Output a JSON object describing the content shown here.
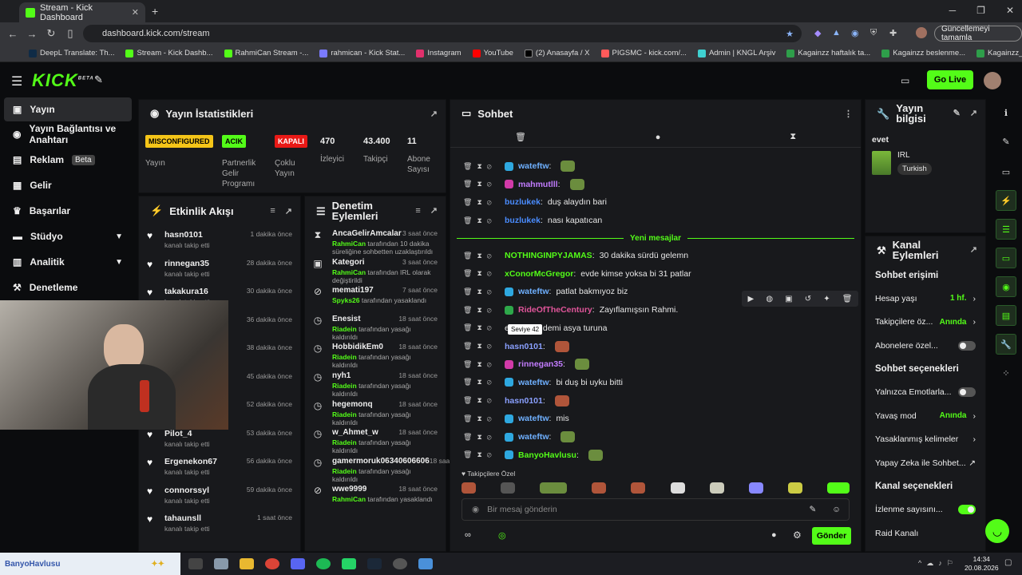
{
  "browser": {
    "tab_title": "Stream - Kick Dashboard",
    "url": "dashboard.kick.com/stream",
    "update_label": "Güncellemeyi tamamla",
    "bookmarks": [
      "DeepL Translate: Th...",
      "Stream - Kick Dashb...",
      "RahmiCan Stream -...",
      "rahmican - Kick Stat...",
      "Instagram",
      "YouTube",
      "(2) Anasayfa / X",
      "PIGSMC - kick.com/...",
      "Admin | KNGL Arşiv",
      "Kagainzz haftalık ta...",
      "Kagainzz beslenme...",
      "Kagainzz_PPLXUL -..."
    ]
  },
  "header": {
    "logo": "KICK",
    "beta": "BETA",
    "go_live": "Go Live"
  },
  "sidebar": {
    "items": [
      {
        "label": "Yayın",
        "icon": "video-icon"
      },
      {
        "label": "Yayın Bağlantısı ve Anahtarı",
        "icon": "broadcast-icon"
      },
      {
        "label": "Reklam",
        "icon": "ad-icon",
        "badge": "Beta"
      },
      {
        "label": "Gelir",
        "icon": "money-icon"
      },
      {
        "label": "Başarılar",
        "icon": "trophy-icon"
      },
      {
        "label": "Stüdyo",
        "icon": "studio-icon"
      },
      {
        "label": "Analitik",
        "icon": "chart-icon"
      },
      {
        "label": "Denetleme",
        "icon": "hammer-icon"
      }
    ]
  },
  "stats": {
    "title": "Yayın İstatistikleri",
    "items": [
      {
        "tag": "MISCONFIGURED",
        "label": "Yayın"
      },
      {
        "tag": "ACIK",
        "label": "Partnerlik Gelir Programı"
      },
      {
        "tag": "KAPALI",
        "label": "Çoklu Yayın"
      },
      {
        "value": "470",
        "label": "İzleyici"
      },
      {
        "value": "43.400",
        "label": "Takipçi"
      },
      {
        "value": "11",
        "label": "Abone Sayısı"
      }
    ]
  },
  "activity": {
    "title": "Etkinlik Akışı",
    "items": [
      {
        "name": "hasn0101",
        "sub": "kanalı takip etti",
        "time": "1 dakika önce"
      },
      {
        "name": "rinnegan35",
        "sub": "kanalı takip etti",
        "time": "28 dakika önce"
      },
      {
        "name": "takakura16",
        "sub": "kanalı takip etti",
        "time": "30 dakika önce"
      },
      {
        "name": "",
        "sub": "",
        "time": "36 dakika önce"
      },
      {
        "name": "",
        "sub": "",
        "time": "38 dakika önce"
      },
      {
        "name": "",
        "sub": "",
        "time": "45 dakika önce"
      },
      {
        "name": "",
        "sub": "",
        "time": "52 dakika önce"
      },
      {
        "name": "Pilot_4",
        "sub": "kanalı takip etti",
        "time": "53 dakika önce"
      },
      {
        "name": "Ergenekon67",
        "sub": "kanalı takip etti",
        "time": "56 dakika önce"
      },
      {
        "name": "connorssyl",
        "sub": "kanalı takip etti",
        "time": "59 dakika önce"
      },
      {
        "name": "tahaunsll",
        "sub": "kanalı takip etti",
        "time": "1 saat önce"
      }
    ]
  },
  "moderation": {
    "title": "Denetim Eylemleri",
    "items": [
      {
        "icon": "hourglass-icon",
        "name": "AncaGelirAmcalar",
        "time": "3 saat önce",
        "by": "RahmiCan",
        "sub": " tarafından 10 dakika süreliğine sohbetten uzaklaştırıldı"
      },
      {
        "icon": "category-icon",
        "name": "Kategori",
        "time": "3 saat önce",
        "by": "RahmiCan",
        "sub": " tarafından IRL olarak değiştirildi"
      },
      {
        "icon": "ban-icon",
        "name": "memati197",
        "time": "7 saat önce",
        "by": "Spyks26",
        "sub": " tarafından yasaklandı"
      },
      {
        "icon": "clock-icon",
        "name": "Enesist",
        "time": "18 saat önce",
        "by": "Riadein",
        "sub": " tarafından yasağı kaldırıldı"
      },
      {
        "icon": "clock-icon",
        "name": "HobbidikEm0",
        "time": "18 saat önce",
        "by": "Riadein",
        "sub": " tarafından yasağı kaldırıldı"
      },
      {
        "icon": "clock-icon",
        "name": "nyh1",
        "time": "18 saat önce",
        "by": "Riadein",
        "sub": " tarafından yasağı kaldırıldı"
      },
      {
        "icon": "clock-icon",
        "name": "hegemonq",
        "time": "18 saat önce",
        "by": "Riadein",
        "sub": " tarafından yasağı kaldırıldı"
      },
      {
        "icon": "clock-icon",
        "name": "w_Ahmet_w",
        "time": "18 saat önce",
        "by": "Riadein",
        "sub": " tarafından yasağı kaldırıldı"
      },
      {
        "icon": "clock-icon",
        "name": "gamermoruk06340606606",
        "time": "18 saat önce",
        "by": "Riadein",
        "sub": " tarafından yasağı kaldırıldı"
      },
      {
        "icon": "ban-icon",
        "name": "wwe9999",
        "time": "18 saat önce",
        "by": "RahmiCan",
        "sub": " tarafından yasaklandı"
      }
    ]
  },
  "chat": {
    "title": "Sohbet",
    "new_messages": "Yeni mesajlar",
    "messages_before": [
      {
        "user": "wateftw",
        "color": "#6fb0ff",
        "badge": "blue",
        "text": "",
        "emote": true
      },
      {
        "user": "mahmutlll",
        "color": "#c27cff",
        "badge": "pink",
        "text": "",
        "emote": true
      },
      {
        "user": "buzlukek",
        "color": "#4a8cff",
        "badge": "",
        "text": "duş alaydın bari"
      },
      {
        "user": "buzlukek",
        "color": "#4a8cff",
        "badge": "",
        "text": "nası kapatıcan"
      }
    ],
    "messages_after": [
      {
        "user": "NOTHINGINPYJAMAS",
        "color": "#53fc18",
        "badge": "",
        "text": "30 dakika sürdü gelemn"
      },
      {
        "user": "xConorMcGregor",
        "color": "#53fc18",
        "badge": "",
        "text": "evde kimse yoksa bi 31 patlar"
      },
      {
        "user": "wateftw",
        "color": "#6fb0ff",
        "badge": "blue",
        "text": "patlat bakmıyoz biz"
      },
      {
        "user": "RideOfTheCentury",
        "color": "#e0559a",
        "badge": "green",
        "text": "Zayıflamışsın Rahmi."
      },
      {
        "user": "",
        "color": "#6fb0ff",
        "badge": "",
        "text": "e: gidicen demi asya turuna"
      },
      {
        "user": "hasn0101",
        "color": "#8aa0ff",
        "badge": "",
        "text": "",
        "emote": true
      },
      {
        "user": "rinnegan35",
        "color": "#c27cff",
        "badge": "pink",
        "text": "",
        "emote": true
      },
      {
        "user": "wateftw",
        "color": "#6fb0ff",
        "badge": "blue",
        "text": "bi duş bi uyku bitti"
      },
      {
        "user": "hasn0101",
        "color": "#8aa0ff",
        "badge": "",
        "text": "",
        "emote": true
      },
      {
        "user": "wateftw",
        "color": "#6fb0ff",
        "badge": "blue",
        "text": "mis"
      },
      {
        "user": "wateftw",
        "color": "#6fb0ff",
        "badge": "blue",
        "text": "",
        "emote": true
      },
      {
        "user": "BanyoHavlusu",
        "color": "#53fc18",
        "badge": "blue",
        "text": "",
        "emote": true
      }
    ],
    "tooltip": "Seviye 42",
    "followers_only": "Takipçilere Özel",
    "input_placeholder": "Bir mesaj gönderin",
    "send": "Gönder"
  },
  "stream_info": {
    "title": "Yayın bilgisi",
    "desc": "evet",
    "category": "IRL",
    "tag": "Turkish"
  },
  "channel_actions": {
    "title": "Kanal Eylemleri",
    "chat_access": "Sohbet erişimi",
    "rows1": [
      {
        "label": "Hesap yaşı",
        "value": "1 hf.",
        "type": "value"
      },
      {
        "label": "Takipçilere öz...",
        "value": "Anında",
        "type": "value"
      },
      {
        "label": "Abonelere özel...",
        "type": "toggle",
        "on": false
      }
    ],
    "chat_options": "Sohbet seçenekleri",
    "rows2": [
      {
        "label": "Yalnızca Emotlarla...",
        "type": "toggle",
        "on": false
      },
      {
        "label": "Yavaş mod",
        "value": "Anında",
        "type": "value"
      },
      {
        "label": "Yasaklanmış kelimeler",
        "type": "chev"
      },
      {
        "label": "Yapay Zeka ile Sohbet...",
        "type": "ext"
      }
    ],
    "channel_options": "Kanal seçenekleri",
    "rows3": [
      {
        "label": "İzlenme sayısını...",
        "type": "toggle",
        "on": true
      },
      {
        "label": "Raid Kanalı",
        "type": "none"
      }
    ]
  },
  "taskbar": {
    "time": "14:34",
    "date": "20.08.2026",
    "user": "BanyoHavlusu"
  }
}
